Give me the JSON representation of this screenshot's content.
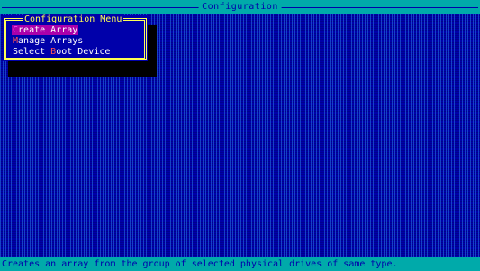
{
  "title_bar": {
    "title": "Configuration"
  },
  "menu": {
    "title": "Configuration Menu",
    "items": [
      {
        "hotkey": "C",
        "rest": "reate Array",
        "selected": true
      },
      {
        "hotkey": "M",
        "rest": "anage Arrays",
        "selected": false
      },
      {
        "prefix": "Select ",
        "hotkey": "B",
        "rest": "oot Device",
        "selected": false
      }
    ]
  },
  "status_bar": {
    "text": "Creates an array from the group of selected physical drives of same type."
  },
  "colors": {
    "desktop": "#0000aa",
    "bars": "#00aaaa",
    "frame": "#ffff55",
    "highlight": "#aa00aa",
    "hotkey": "#ff5555"
  }
}
